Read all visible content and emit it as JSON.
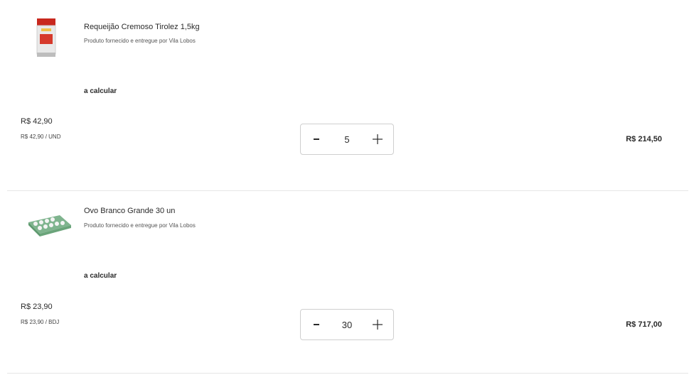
{
  "items": [
    {
      "name": "Requeijão Cremoso Tirolez 1,5kg",
      "seller": "Produto fornecido e entregue por Vila Lobos",
      "shipping": "a calcular",
      "price": "R$ 42,90",
      "price_detail": "R$ 42,90 / UND",
      "quantity": "5",
      "total": "R$ 214,50",
      "image_icon": "requeijao-bucket-icon"
    },
    {
      "name": "Ovo Branco Grande 30 un",
      "seller": "Produto fornecido e entregue por Vila Lobos",
      "shipping": "a calcular",
      "price": "R$ 23,90",
      "price_detail": "R$ 23,90 / BDJ",
      "quantity": "30",
      "total": "R$ 717,00",
      "image_icon": "egg-tray-icon"
    }
  ],
  "stepper": {
    "decrement_label": "-",
    "increment_icon": "plus-icon"
  },
  "colors": {
    "border": "#cfcfcf",
    "divider": "#e6e6e6",
    "text": "#2a2a2a"
  }
}
